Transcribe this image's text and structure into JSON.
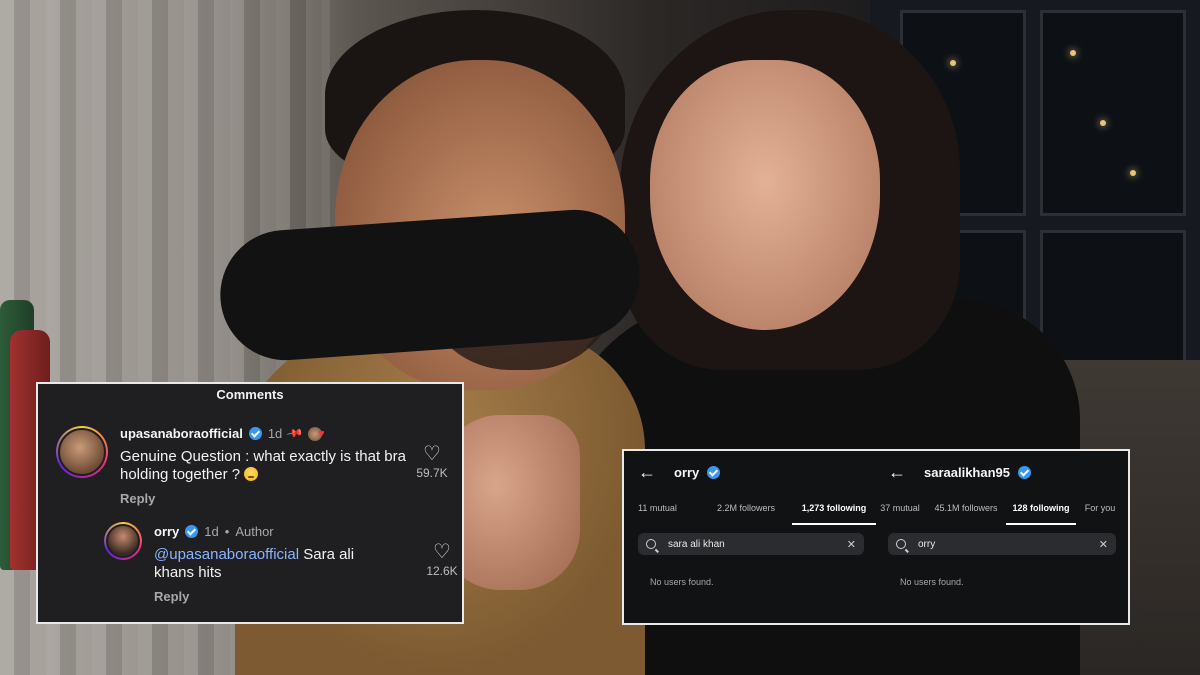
{
  "comments": {
    "title": "Comments",
    "items": [
      {
        "username": "upasanaboraofficial",
        "time": "1d",
        "text": "Genuine Question : what exactly is that bra holding together ?",
        "reply_label": "Reply",
        "likes": "59.7K"
      },
      {
        "username": "orry",
        "time": "1d",
        "author_label": "Author",
        "mention": "@upasanaboraofficial",
        "text": "Sara ali khans hits",
        "reply_label": "Reply",
        "likes": "12.6K"
      }
    ]
  },
  "following": {
    "left": {
      "username": "orry",
      "tabs": [
        "11 mutual",
        "2.2M followers",
        "1,273 following"
      ],
      "active_tab": "1,273 following",
      "search_value": "sara ali khan",
      "empty_text": "No users found."
    },
    "right": {
      "username": "saraalikhan95",
      "tabs": [
        "37 mutual",
        "45.1M followers",
        "128 following",
        "For you"
      ],
      "active_tab": "128 following",
      "search_value": "orry",
      "empty_text": "No users found."
    }
  },
  "colors": {
    "verified": "#3897f0",
    "mention": "#8ab4ff",
    "panel_bg": "#1f1f22",
    "follow_bg": "#111214"
  },
  "icons": [
    "verified-icon",
    "pin-icon",
    "heart-icon",
    "back-arrow-icon",
    "search-icon",
    "clear-icon"
  ]
}
